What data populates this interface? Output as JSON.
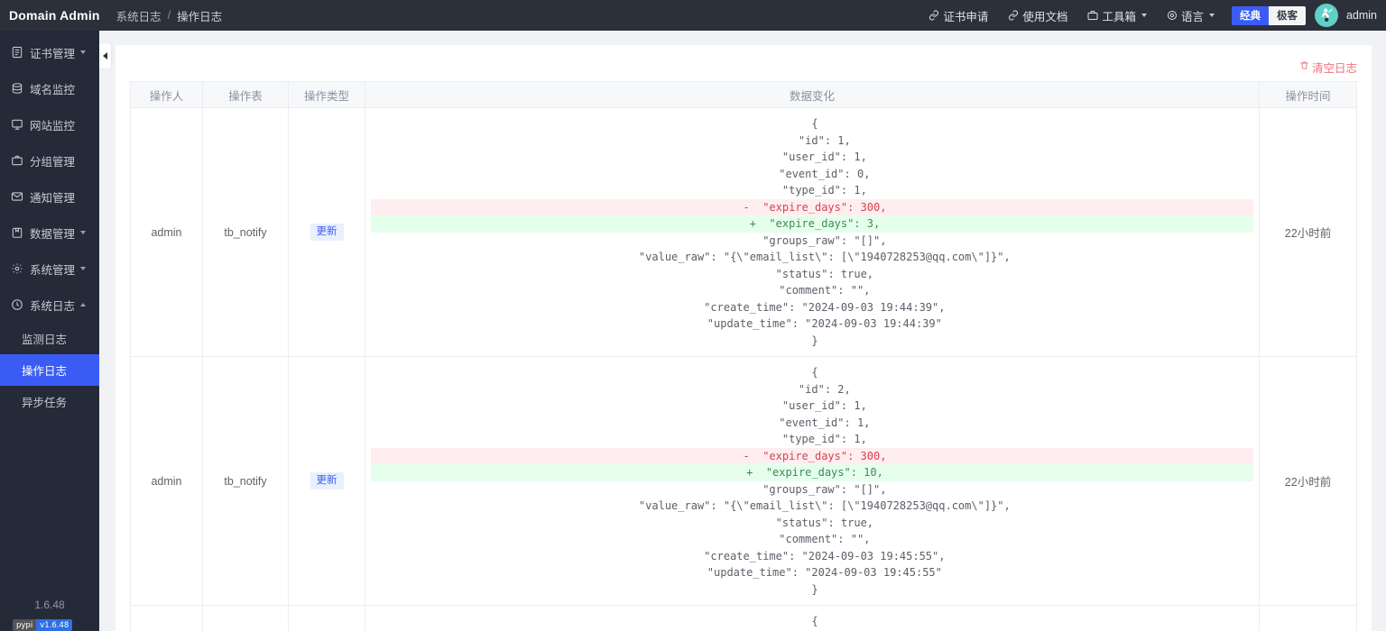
{
  "topbar": {
    "brand": "Domain Admin",
    "breadcrumb": [
      "系统日志",
      "操作日志"
    ],
    "breadcrumb_sep": "/",
    "links": [
      {
        "label": "证书申请",
        "icon": "link-icon",
        "caret": false
      },
      {
        "label": "使用文档",
        "icon": "link-icon",
        "caret": false
      },
      {
        "label": "工具箱",
        "icon": "toolbox-icon",
        "caret": true
      },
      {
        "label": "语言",
        "icon": "globe-icon",
        "caret": true
      }
    ],
    "theme": {
      "classic": "经典",
      "geek": "极客",
      "active": "经典"
    },
    "username": "admin"
  },
  "sidebar": {
    "items": [
      {
        "label": "证书管理",
        "icon": "certificate-icon",
        "arrow": "down"
      },
      {
        "label": "域名监控",
        "icon": "database-icon",
        "arrow": "none"
      },
      {
        "label": "网站监控",
        "icon": "monitor-icon",
        "arrow": "none"
      },
      {
        "label": "分组管理",
        "icon": "folder-icon",
        "arrow": "none"
      },
      {
        "label": "通知管理",
        "icon": "mail-icon",
        "arrow": "none"
      },
      {
        "label": "数据管理",
        "icon": "box-icon",
        "arrow": "down"
      },
      {
        "label": "系统管理",
        "icon": "gear-icon",
        "arrow": "down"
      },
      {
        "label": "系统日志",
        "icon": "clock-icon",
        "arrow": "up"
      }
    ],
    "submenu": [
      {
        "label": "监测日志",
        "active": false
      },
      {
        "label": "操作日志",
        "active": true
      },
      {
        "label": "异步任务",
        "active": false
      }
    ],
    "version": "1.6.48",
    "badge": {
      "left": "pypi",
      "right": "v1.6.48"
    }
  },
  "main": {
    "clear_log_label": "清空日志",
    "clear_log_icon": "trash-icon",
    "columns": [
      "操作人",
      "操作表",
      "操作类型",
      "数据变化",
      "操作时间"
    ],
    "rows": [
      {
        "operator": "admin",
        "table": "tb_notify",
        "type": "更新",
        "time": "22小时前",
        "diff": [
          {
            "kind": "ctx",
            "text": "{"
          },
          {
            "kind": "ctx",
            "text": "   \"id\": 1,"
          },
          {
            "kind": "ctx",
            "text": "   \"user_id\": 1,"
          },
          {
            "kind": "ctx",
            "text": "   \"event_id\": 0,"
          },
          {
            "kind": "ctx",
            "text": "   \"type_id\": 1,"
          },
          {
            "kind": "del",
            "text": "-  \"expire_days\": 300,"
          },
          {
            "kind": "add",
            "text": "+  \"expire_days\": 3,"
          },
          {
            "kind": "ctx",
            "text": "   \"groups_raw\": \"[]\","
          },
          {
            "kind": "ctx",
            "text": "   \"value_raw\": \"{\\\"email_list\\\": [\\\"1940728253@qq.com\\\"]}\","
          },
          {
            "kind": "ctx",
            "text": "   \"status\": true,"
          },
          {
            "kind": "ctx",
            "text": "   \"comment\": \"\","
          },
          {
            "kind": "ctx",
            "text": "   \"create_time\": \"2024-09-03 19:44:39\","
          },
          {
            "kind": "ctx",
            "text": "   \"update_time\": \"2024-09-03 19:44:39\""
          },
          {
            "kind": "ctx",
            "text": "}"
          }
        ]
      },
      {
        "operator": "admin",
        "table": "tb_notify",
        "type": "更新",
        "time": "22小时前",
        "diff": [
          {
            "kind": "ctx",
            "text": "{"
          },
          {
            "kind": "ctx",
            "text": "   \"id\": 2,"
          },
          {
            "kind": "ctx",
            "text": "   \"user_id\": 1,"
          },
          {
            "kind": "ctx",
            "text": "   \"event_id\": 1,"
          },
          {
            "kind": "ctx",
            "text": "   \"type_id\": 1,"
          },
          {
            "kind": "del",
            "text": "-  \"expire_days\": 300,"
          },
          {
            "kind": "add",
            "text": "+  \"expire_days\": 10,"
          },
          {
            "kind": "ctx",
            "text": "   \"groups_raw\": \"[]\","
          },
          {
            "kind": "ctx",
            "text": "   \"value_raw\": \"{\\\"email_list\\\": [\\\"1940728253@qq.com\\\"]}\","
          },
          {
            "kind": "ctx",
            "text": "   \"status\": true,"
          },
          {
            "kind": "ctx",
            "text": "   \"comment\": \"\","
          },
          {
            "kind": "ctx",
            "text": "   \"create_time\": \"2024-09-03 19:45:55\","
          },
          {
            "kind": "ctx",
            "text": "   \"update_time\": \"2024-09-03 19:45:55\""
          },
          {
            "kind": "ctx",
            "text": "}"
          }
        ]
      },
      {
        "operator": "",
        "table": "",
        "type": "",
        "time": "",
        "diff": [
          {
            "kind": "ctx",
            "text": "{"
          }
        ]
      }
    ]
  },
  "colors": {
    "accent": "#3a5cf5",
    "topbar_bg": "#2b303b",
    "sidebar_bg": "#242a38",
    "danger": "#f5707a",
    "diff_add": "#e6ffed",
    "diff_del": "#ffeef0",
    "avatar_bg": "#5fd0c8"
  }
}
